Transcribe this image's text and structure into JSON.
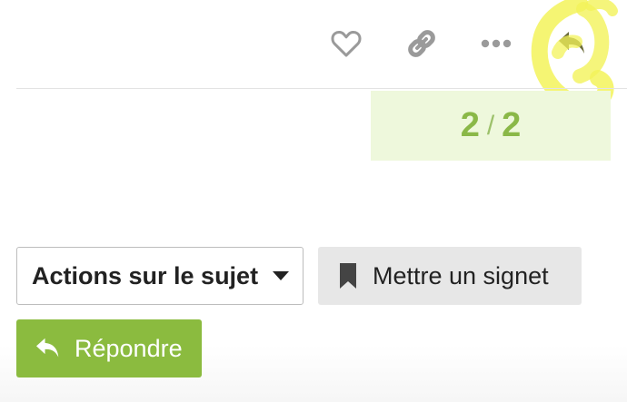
{
  "post_controls": {
    "like_icon": "heart-icon",
    "link_icon": "link-icon",
    "more_icon": "ellipsis-icon",
    "reply_icon": "reply-arrow-icon"
  },
  "progress": {
    "current": "2",
    "separator": "/",
    "total": "2"
  },
  "topic_footer": {
    "topic_actions_label": "Actions sur le sujet",
    "bookmark_label": "Mettre un signet",
    "reply_label": "Répondre"
  },
  "colors": {
    "accent_green": "#8bbb3f",
    "progress_bg": "#eef8dc",
    "progress_text": "#8ab848",
    "icon_gray": "#9a9a9a",
    "highlighter_yellow": "#f3f35a"
  }
}
